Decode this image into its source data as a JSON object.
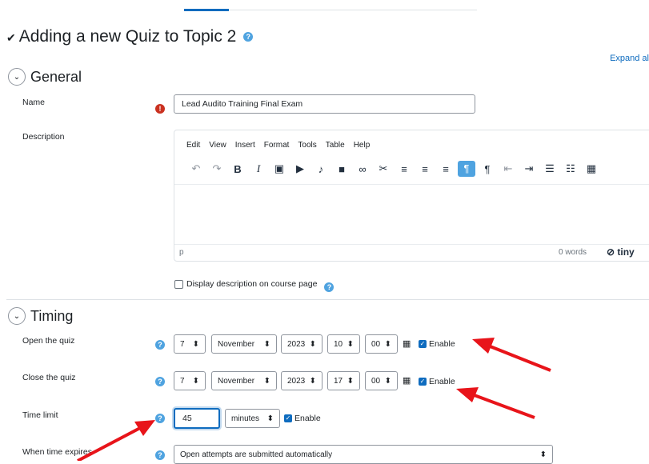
{
  "page": {
    "title": "Adding a new Quiz to Topic 2",
    "expand_all": "Expand al"
  },
  "general": {
    "heading": "General",
    "name_label": "Name",
    "name_value": "Lead Audito Training Final Exam",
    "description_label": "Description",
    "editor": {
      "menu": [
        "Edit",
        "View",
        "Insert",
        "Format",
        "Tools",
        "Table",
        "Help"
      ],
      "path": "p",
      "word_count": "0 words",
      "brand": "tiny"
    },
    "display_description": "Display description on course page"
  },
  "timing": {
    "heading": "Timing",
    "open": {
      "label": "Open the quiz",
      "day": "7",
      "month": "November",
      "year": "2023",
      "hour": "10",
      "minute": "00",
      "enable": "Enable"
    },
    "close": {
      "label": "Close the quiz",
      "day": "7",
      "month": "November",
      "year": "2023",
      "hour": "17",
      "minute": "00",
      "enable": "Enable"
    },
    "time_limit": {
      "label": "Time limit",
      "value": "45",
      "unit": "minutes",
      "enable": "Enable"
    },
    "expire": {
      "label": "When time expires",
      "value": "Open attempts are submitted automatically"
    }
  },
  "colors": {
    "accent": "#0f6cbf",
    "help": "#4fa3e0",
    "error": "#ca3120",
    "arrow": "#e8141a"
  }
}
